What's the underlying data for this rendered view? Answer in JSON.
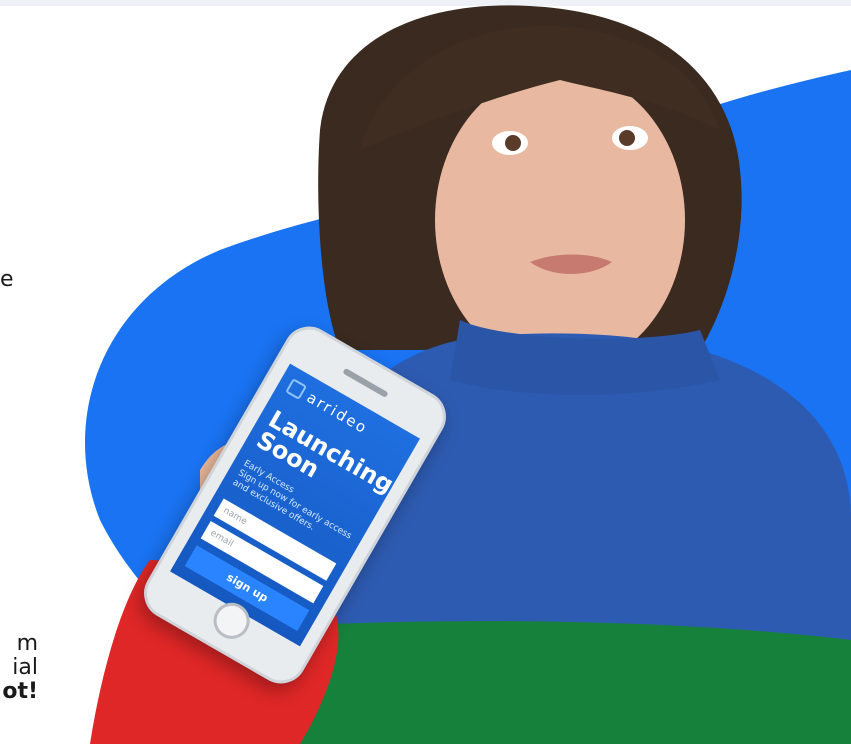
{
  "left_text": {
    "line_e": "e",
    "bottom_lines": [
      "m",
      "ial",
      "ot!"
    ]
  },
  "phone_screen": {
    "logo_text": "arrideo",
    "headline_line1": "Launching",
    "headline_line2": "Soon",
    "subtitle_1": "Early Access",
    "subtitle_2": "Sign up now for early access",
    "subtitle_3": "and exclusive offers.",
    "name_placeholder": "name",
    "email_placeholder": "email",
    "signup_label": "sign up"
  },
  "colors": {
    "blob": "#1a73f2",
    "phone_screen": "#1f6fe0"
  }
}
